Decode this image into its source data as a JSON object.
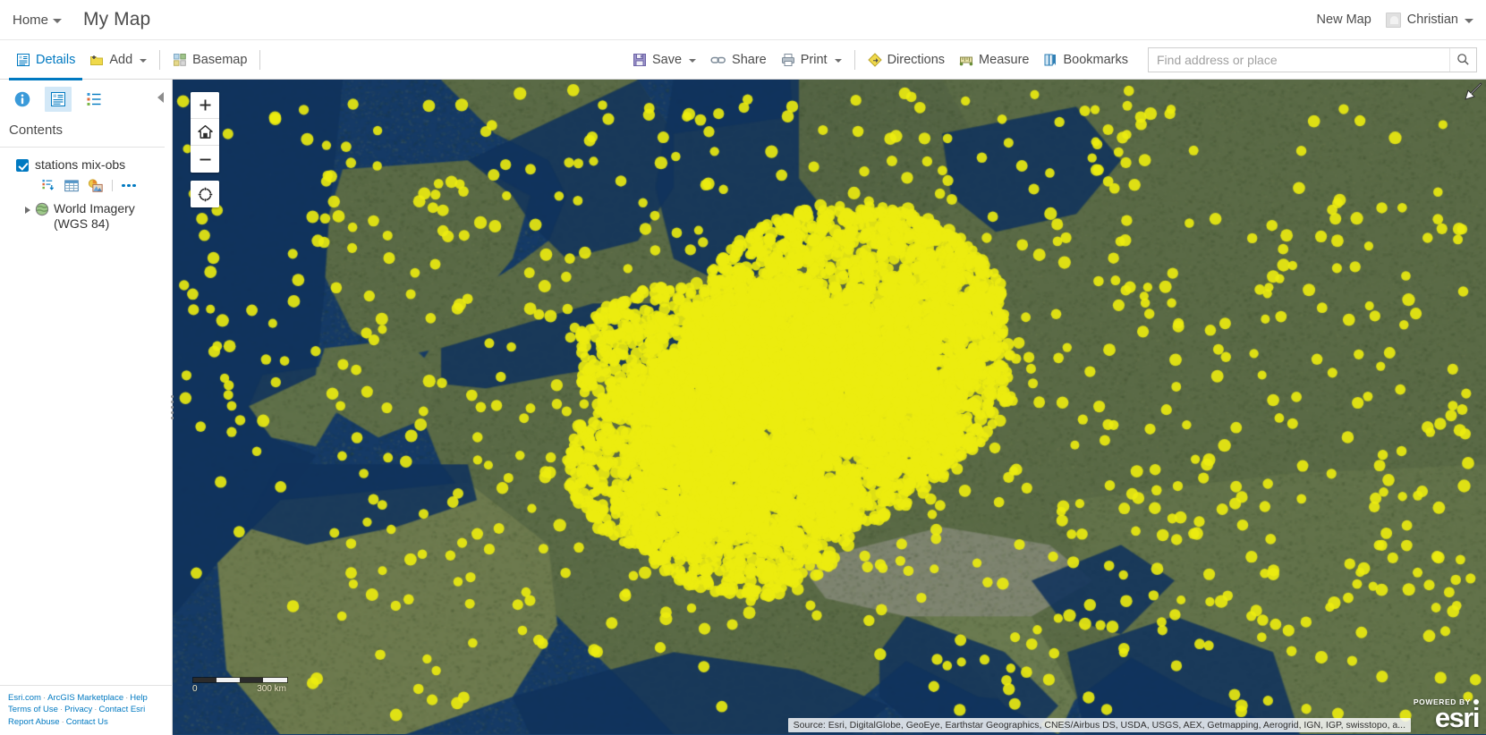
{
  "topbar": {
    "home_label": "Home",
    "map_title": "My Map",
    "new_map_label": "New Map",
    "user_name": "Christian"
  },
  "toolbar": {
    "details_label": "Details",
    "add_label": "Add",
    "basemap_label": "Basemap",
    "save_label": "Save",
    "share_label": "Share",
    "print_label": "Print",
    "directions_label": "Directions",
    "measure_label": "Measure",
    "bookmarks_label": "Bookmarks",
    "search_placeholder": "Find address or place",
    "search_value": ""
  },
  "sidebar": {
    "contents_title": "Contents",
    "layers": [
      {
        "name": "stations mix-obs",
        "checked": true
      },
      {
        "name": "World Imagery (WGS 84)",
        "checked": false
      }
    ],
    "footer_links_row1": [
      "Esri.com",
      "ArcGIS Marketplace",
      "Help"
    ],
    "footer_links_row2": [
      "Terms of Use",
      "Privacy",
      "Contact Esri"
    ],
    "footer_links_row3": [
      "Report Abuse",
      "Contact Us"
    ]
  },
  "map": {
    "scale_min_label": "0",
    "scale_max_label": "300 km",
    "attribution": "Source: Esri, DigitalGlobe, GeoEye, Earthstar Geographics, CNES/Airbus DS, USDA, USGS, AEX, Getmapping, Aerogrid, IGN, IGP, swisstopo, a...",
    "powered_by_label": "POWERED BY",
    "esri_wordmark": "esri",
    "point_color": "#ecec10",
    "accent_color": "#0079c1"
  }
}
